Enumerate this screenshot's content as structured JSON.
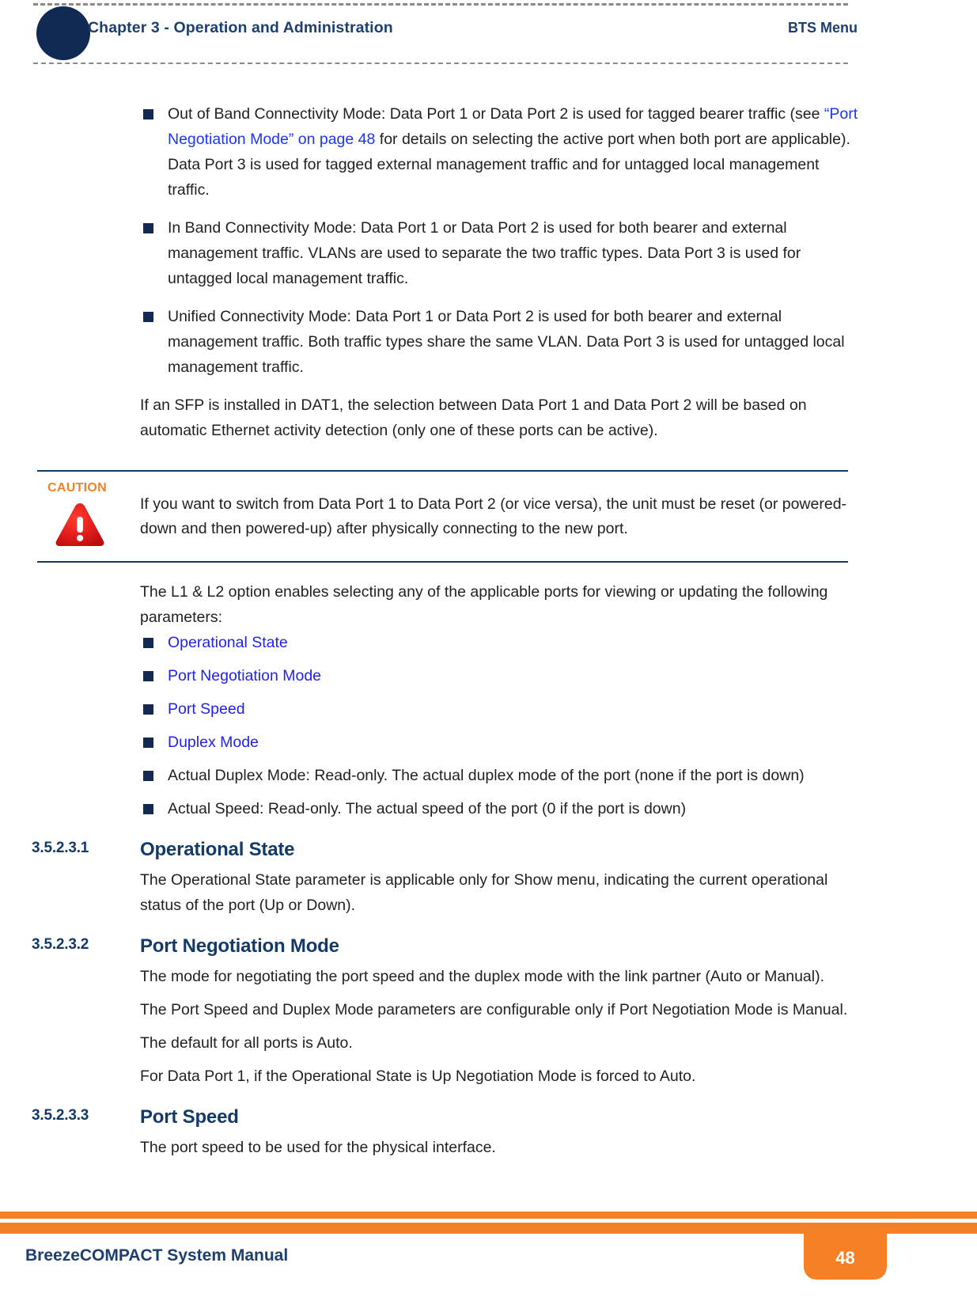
{
  "header": {
    "chapter": "Chapter 3 - Operation and Administration",
    "section": "BTS Menu"
  },
  "bullets_modes": [
    {
      "pre": "Out of Band Connectivity Mode: Data Port 1 or Data Port 2 is used for tagged bearer traffic (see ",
      "link": "“Port Negotiation Mode” on page 48",
      "post": " for details on selecting the active port when both port are applicable). Data Port 3 is used for tagged external management traffic and for untagged local management traffic."
    },
    {
      "text": "In Band Connectivity Mode: Data Port 1 or Data Port 2 is used for both bearer and external management traffic. VLANs are used to separate the two traffic types. Data Port 3 is used for untagged local management traffic."
    },
    {
      "text": "Unified Connectivity Mode: Data Port 1 or Data Port 2 is used for both bearer and external management traffic. Both traffic types share the same VLAN. Data Port 3 is used for untagged local management traffic."
    }
  ],
  "sfp_note": "If an SFP is installed in DAT1, the selection between Data Port 1 and Data Port 2 will be based on automatic Ethernet activity detection (only one of these ports can be active).",
  "caution": {
    "label": "CAUTION",
    "text": "If you want to switch from Data Port 1 to Data Port 2 (or vice versa), the unit must be reset (or powered-down and then powered-up) after physically connecting to the new port."
  },
  "l1l2_intro": "The L1 & L2 option enables selecting any of the applicable ports for viewing or updating the following parameters:",
  "param_bullets": [
    {
      "text": "Operational State",
      "link": true
    },
    {
      "text": "Port Negotiation Mode",
      "link": true
    },
    {
      "text": "Port Speed",
      "link": true
    },
    {
      "text": "Duplex Mode",
      "link": true
    },
    {
      "text": "Actual Duplex Mode: Read-only. The actual duplex mode of the port (none if the port is down)",
      "link": false
    },
    {
      "text": "Actual Speed: Read-only. The actual speed of the port (0 if the port is down)",
      "link": false
    }
  ],
  "sections": [
    {
      "number": "3.5.2.3.1",
      "title": "Operational State",
      "paragraphs": [
        "The Operational State parameter is applicable only for Show menu, indicating the current operational status of the port (Up or Down)."
      ]
    },
    {
      "number": "3.5.2.3.2",
      "title": "Port Negotiation Mode",
      "paragraphs": [
        "The mode for negotiating the port speed and the duplex mode with the link partner (Auto or Manual).",
        "The Port Speed and Duplex Mode parameters are configurable only if Port Negotiation Mode is Manual.",
        "The default for all ports is Auto.",
        "For Data Port 1, if the Operational State is Up Negotiation Mode is forced to Auto."
      ]
    },
    {
      "number": "3.5.2.3.3",
      "title": "Port Speed",
      "paragraphs": [
        "The port speed to be used for the physical interface."
      ]
    }
  ],
  "footer": {
    "title": "BreezeCOMPACT System Manual",
    "page": "48"
  },
  "colors": {
    "navy": "#102a53",
    "heading_navy": "#143a66",
    "header_blue": "#1d3f6e",
    "link_blue": "#1a35ff",
    "orange": "#f58025",
    "caution_red": "#e01b1b",
    "body": "#231f20"
  }
}
